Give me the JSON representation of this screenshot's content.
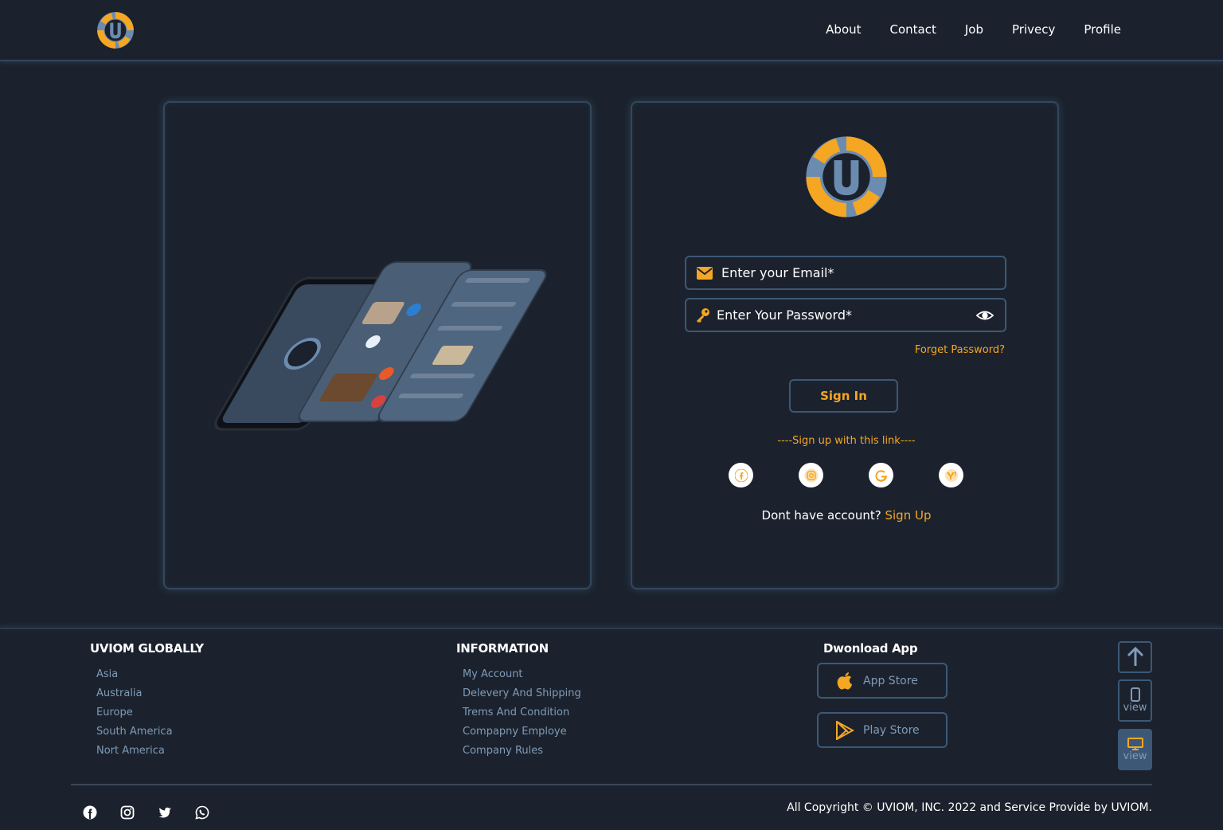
{
  "nav": {
    "items": [
      "About",
      "Contact",
      "Job",
      "Privecy",
      "Profile"
    ]
  },
  "login": {
    "email_placeholder": "Enter your Email*",
    "password_placeholder": "Enter Your Password*",
    "forget_label": "Forget Password?",
    "signin_label": "Sign In",
    "signup_link_text": "----Sign up with this link----",
    "no_account_text": "Dont have account?",
    "signup_label": "Sign Up",
    "social_icons": [
      "facebook-icon",
      "instagram-icon",
      "google-icon",
      "yahoo-icon"
    ]
  },
  "footer": {
    "globally": {
      "title": "UVIOM GLOBALLY",
      "items": [
        "Asia",
        "Australia",
        "Europe",
        "South America",
        "Nort America"
      ]
    },
    "information": {
      "title": "INFORMATION",
      "items": [
        "My Account",
        "Delevery And Shipping",
        "Trems And Condition",
        "Compapny Employe",
        "Company Rules"
      ]
    },
    "download": {
      "title": "Dwonload App",
      "app_store": "App Store",
      "play_store": "Play Store"
    },
    "side": {
      "mobile_view": "view",
      "desktop_view": "view"
    },
    "copyright": "All Copyright © UVIOM, INC. 2022 and Service Provide by UVIOM.",
    "social_icons": [
      "facebook-icon",
      "instagram-icon",
      "twitter-icon",
      "whatsapp-icon"
    ]
  },
  "colors": {
    "accent": "#f5a623",
    "background": "#1b222d",
    "border": "#3c5876",
    "muted_text": "#7f9bb8"
  }
}
